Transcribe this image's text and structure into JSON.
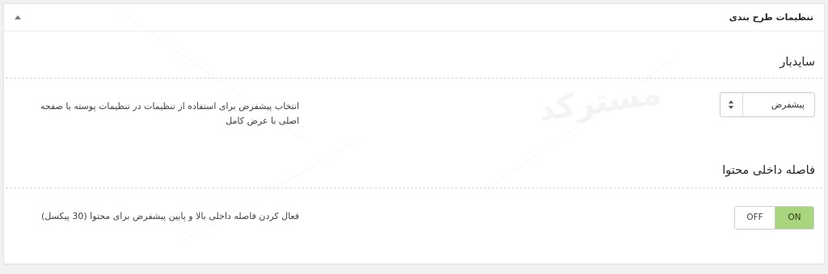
{
  "panel": {
    "title": "تنظیمات طرح بندی"
  },
  "sidebar_section": {
    "title": "سایدبار",
    "description": "انتخاب پیشفرض برای استفاده از تنظیمات در تنظیمات پوسته یا صفحه اصلی با عرض کامل",
    "select_value": "پیشفرض"
  },
  "padding_section": {
    "title": "فاصله داخلی محتوا",
    "description": "فعال کردن فاصله داخلی بالا و پایین پیشفرض برای محتوا (30 پیکسل)",
    "switch_off_label": "OFF",
    "switch_on_label": "ON",
    "switch_state": "on"
  },
  "watermark": {
    "text": "مسترکد"
  },
  "colors": {
    "switch_on_bg": "#a9d57f",
    "panel_bg": "#ffffff",
    "page_bg": "#f1f1f1"
  }
}
